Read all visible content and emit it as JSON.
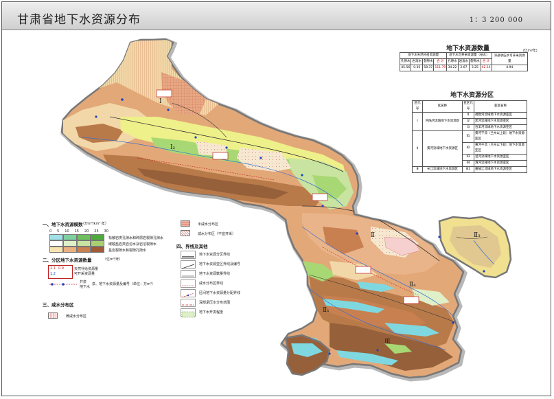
{
  "header": {
    "title": "甘肃省地下水资源分布",
    "scale": "1：3 200 000"
  },
  "quantity_table": {
    "title": "地下水资源数量",
    "unit": "(亿m³/年)",
    "group_headers": [
      "地下水天然补给资源量",
      "地下水可开采资源量（枯水）",
      "深部承压水可开采资源量"
    ],
    "columns": [
      "孔隙水",
      "岩溶水",
      "裂隙水",
      "合 计",
      "孔隙水",
      "岩溶水",
      "裂隙水",
      "合 计"
    ],
    "values": [
      "45.56",
      "0.36",
      "58.37",
      "111.79",
      "34.22",
      "2.67",
      "3.25",
      "42.14",
      "4.94"
    ]
  },
  "zone_table": {
    "title": "地下水资源分区",
    "headers": [
      "区代号",
      "区名称",
      "亚区代号",
      "亚区名称"
    ],
    "rows": [
      {
        "code": "Ⅰ",
        "name": "内陆河流域地下水资源区",
        "subs": [
          {
            "code": "Ⅰ1",
            "name": "疏勒河流域地下水资源亚区"
          },
          {
            "code": "Ⅰ2",
            "name": "黑河流域地下水资源亚区"
          },
          {
            "code": "Ⅰ3",
            "name": "石羊河流域地下水资源亚区"
          }
        ]
      },
      {
        "code": "Ⅱ",
        "name": "黄河流域地下水资源区",
        "subs": [
          {
            "code": "Ⅱ1",
            "name": "黄河干流（兰州以上段）地下水资源亚区"
          },
          {
            "code": "Ⅱ2",
            "name": "黄河干流（兰州以下段）地下水资源亚区"
          },
          {
            "code": "Ⅱ3",
            "name": "泾河流域地下水资源亚区"
          },
          {
            "code": "Ⅱ4",
            "name": "渭河流域地下水资源亚区"
          }
        ]
      },
      {
        "code": "Ⅲ",
        "name": "长江流域地下水资源区",
        "subs": [
          {
            "code": "Ⅲ1",
            "name": "嘉陵江流域地下水资源亚区"
          }
        ]
      }
    ]
  },
  "legend": {
    "section1": {
      "title": "一、地下水资源模数",
      "unit": "（万m³/km²·年）",
      "scale_ticks": [
        "0",
        "5",
        "10",
        "15",
        "20",
        "25",
        "30"
      ],
      "rows": [
        {
          "label": "松散岩类孔隙水和碎屑岩裂隙孔隙水",
          "colors": [
            "#9fe0e8",
            "#7fd0a0",
            "#6dc05c",
            "#4faa3c"
          ]
        },
        {
          "label": "碳酸盐岩类岩溶水及岩溶裂隙水",
          "colors": [
            "#ffffff",
            "#dff0c8",
            "#c8e4a0",
            "#a8d070"
          ]
        },
        {
          "label": "基岩裂隙水和裂隙孔隙水",
          "colors": [
            "#f6e3b0",
            "#e8b080",
            "#c98050",
            "#a05a35"
          ]
        }
      ]
    },
    "section2": {
      "title": "二、分区地下水资源数量",
      "unit": "（亿m³/年）",
      "box_label1": "天然补给资源量",
      "box_label2": "可开采资源量",
      "sample_values": [
        "1.1",
        "0.9",
        "1.2"
      ],
      "line_label1": "井泉",
      "line_label2": "地下水",
      "line_label3": "泉、地下水资源量及编号（单位：万m³）"
    },
    "section3": {
      "title": "三、咸水分布区",
      "item": "微咸水分布区"
    },
    "section_r": {
      "items": [
        "半咸水分布区",
        "咸水分布区（不宜开采）"
      ]
    },
    "section4": {
      "title": "四、界线及其他",
      "items": [
        "地下水资源分区界线",
        "地下水资源亚区界线及编号",
        "地下水资源数量界线",
        "咸水分布区界线",
        "区间地下水资源量分配界线",
        "深部承压水分布范围",
        "地下水开发程度"
      ]
    }
  },
  "map_labels": {
    "zone_I": "Ⅰ",
    "zone_I2": "Ⅰ₂",
    "zone_II": "Ⅱ",
    "zone_II1": "Ⅱ₁",
    "zone_II3": "Ⅱ₃",
    "zone_II4": "Ⅱ₄",
    "zone_III": "Ⅲ"
  },
  "colors": {
    "tan": "#e3a878",
    "brown": "#b97a4a",
    "dark_brown": "#96603a",
    "light_tan": "#f2d8a8",
    "yellow": "#eef08a",
    "green": "#a8d874",
    "cyan": "#7fd8e0",
    "pink": "#f6cfcf",
    "salt_red": "#d77070"
  }
}
